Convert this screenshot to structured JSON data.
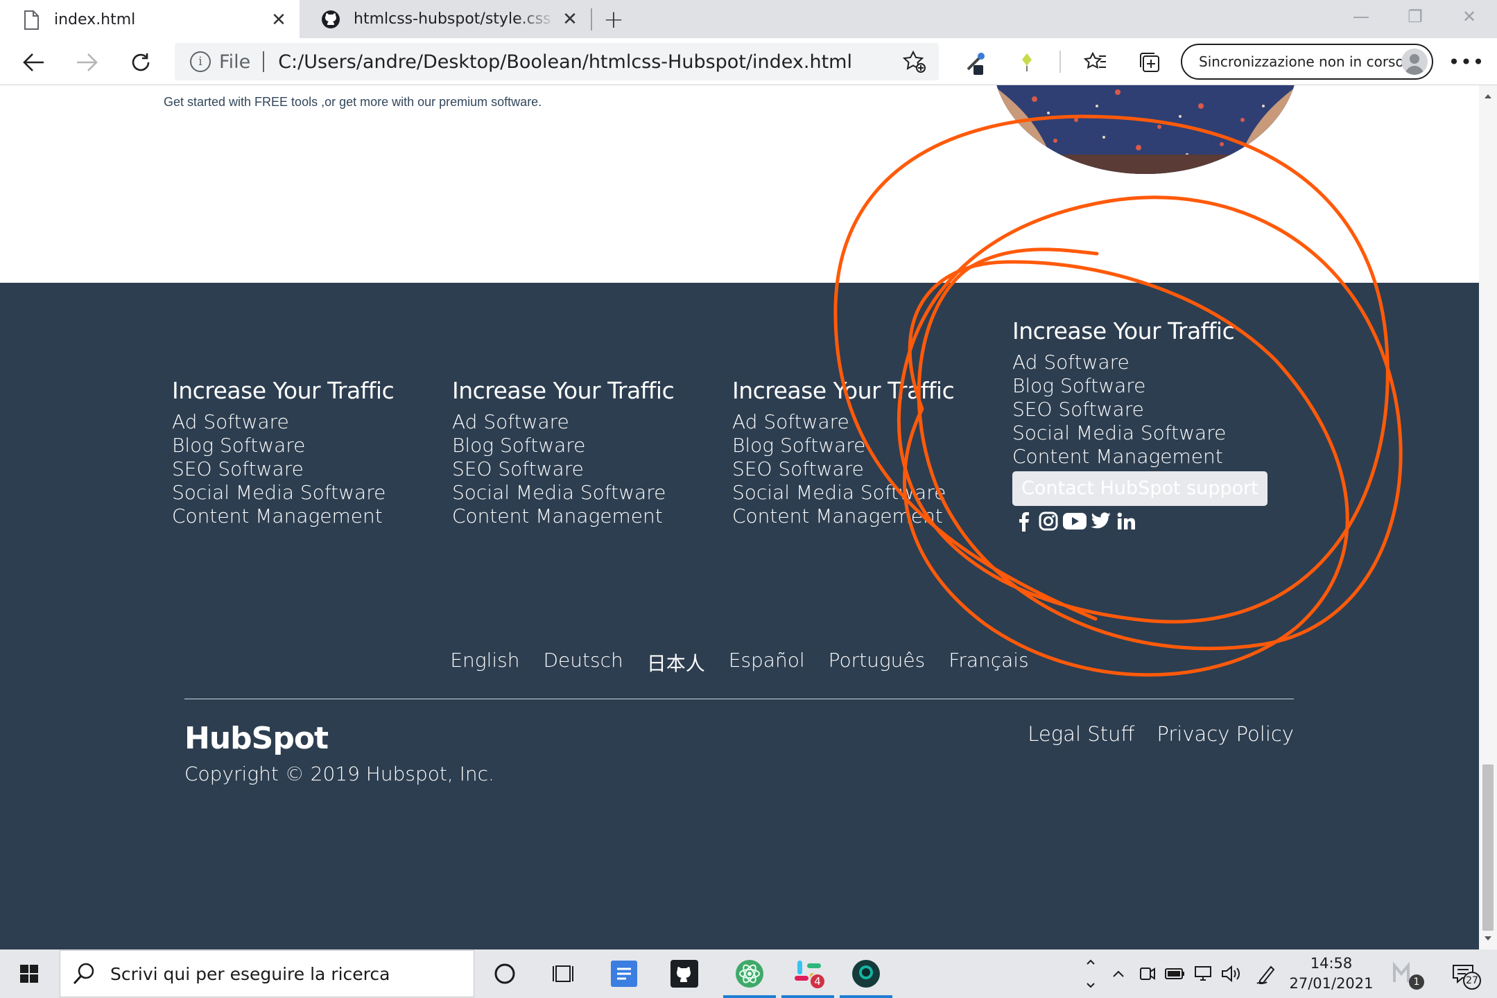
{
  "browser": {
    "tabs": [
      {
        "title": "index.html",
        "active": true,
        "icon": "file-icon"
      },
      {
        "title": "htmlcss-hubspot/style.css at main",
        "active": false,
        "icon": "github-icon"
      }
    ],
    "address": {
      "scheme_label": "File",
      "url": "C:/Users/andre/Desktop/Boolean/htmlcss-Hubspot/index.html"
    },
    "sync_label": "Sincronizzazione non in corso"
  },
  "page": {
    "hero_subtitle": "Get started with FREE tools ,or get more with our premium software.",
    "footer": {
      "columns": [
        {
          "heading": "Increase Your Traffic",
          "links": [
            "Ad Software",
            "Blog Software",
            "SEO Software",
            "Social Media Software",
            "Content Management"
          ]
        },
        {
          "heading": "Increase Your Traffic",
          "links": [
            "Ad Software",
            "Blog Software",
            "SEO Software",
            "Social Media Software",
            "Content Management"
          ]
        },
        {
          "heading": "Increase Your Traffic",
          "links": [
            "Ad Software",
            "Blog Software",
            "SEO Software",
            "Social Media Software",
            "Content Management"
          ]
        },
        {
          "heading": "Increase Your Traffic",
          "links": [
            "Ad Software",
            "Blog Software",
            "SEO Software",
            "Social Media Software",
            "Content Management"
          ],
          "button": "Contact HubSpot support",
          "socials": [
            "facebook-icon",
            "instagram-icon",
            "youtube-icon",
            "twitter-icon",
            "linkedin-icon"
          ]
        }
      ],
      "languages": [
        "English",
        "Deutsch",
        "日本人",
        "Español",
        "Português",
        "Français"
      ],
      "logo_text": "HubSpot",
      "copyright": "Copyright © 2019 Hubspot, Inc.",
      "legal_links": [
        "Legal Stuff",
        "Privacy Policy"
      ]
    }
  },
  "taskbar": {
    "search_placeholder": "Scrivi qui per eseguire la ricerca",
    "time": "14:58",
    "date": "27/01/2021",
    "notification_count": "27",
    "slack_badge": "4",
    "tray_badge": "1"
  },
  "colors": {
    "footer_bg": "#2d3e50",
    "annotation_stroke": "#ff5a0a",
    "button_bg": "#e7e9ec"
  }
}
